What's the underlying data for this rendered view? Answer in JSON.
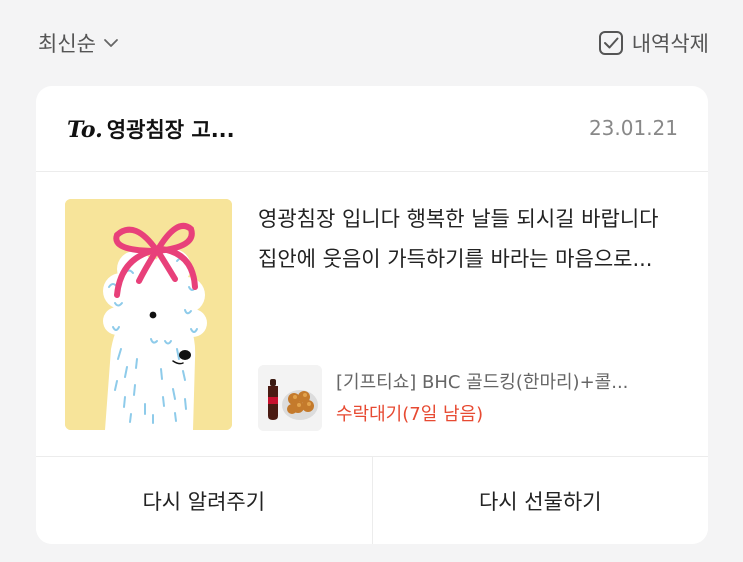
{
  "toolbar": {
    "sort_label": "최신순",
    "delete_label": "내역삭제"
  },
  "card": {
    "to_prefix": "To.",
    "recipient": "영광침장 고...",
    "date": "23.01.21",
    "message": "영광침장 입니다 행복한 날들 되시길 바랍니다 집안에 웃음이 가득하기를 바라는 마음으로...",
    "gift": {
      "name": "[기프티쇼] BHC 골드킹(한마리)+콜...",
      "status": "수락대기(7일 남음)"
    },
    "actions": {
      "remind_label": "다시 알려주기",
      "regift_label": "다시 선물하기"
    }
  },
  "colors": {
    "status": "#e74a32",
    "card_bg": "#f7e49a",
    "ribbon": "#e8407a"
  }
}
